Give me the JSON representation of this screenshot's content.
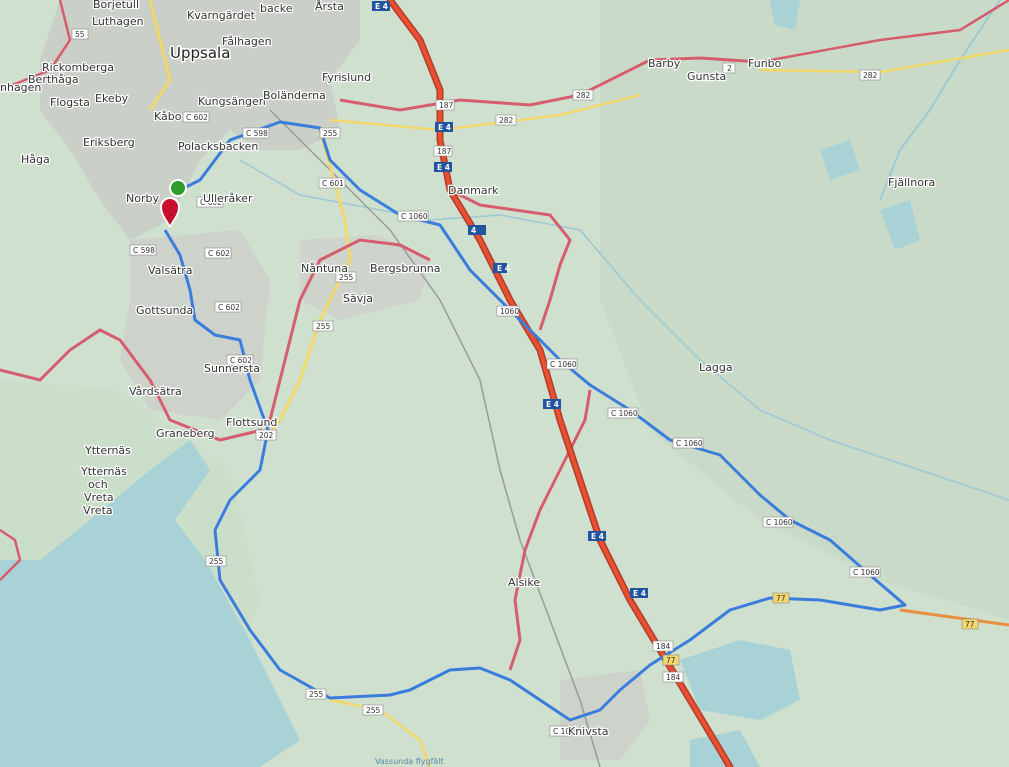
{
  "map": {
    "places": [
      {
        "id": "borjetull",
        "label": "Borjetull"
      },
      {
        "id": "luthagen",
        "label": "Luthagen"
      },
      {
        "id": "kvarngardet",
        "label": "Kvarngärdet"
      },
      {
        "id": "backe",
        "label": "backe"
      },
      {
        "id": "arsta",
        "label": "Årsta"
      },
      {
        "id": "uppsala",
        "label": "Uppsala"
      },
      {
        "id": "falhagen",
        "label": "Fålhagen"
      },
      {
        "id": "rickomberga",
        "label": "Rickomberga"
      },
      {
        "id": "berthaga",
        "label": "Berthåga"
      },
      {
        "id": "nhagen",
        "label": "nhagen"
      },
      {
        "id": "flogsta",
        "label": "Flogsta"
      },
      {
        "id": "ekeby",
        "label": "Ekeby"
      },
      {
        "id": "fyrislund",
        "label": "Fyrislund"
      },
      {
        "id": "kungsangen",
        "label": "Kungsängen"
      },
      {
        "id": "bolanderna",
        "label": "Boländerna"
      },
      {
        "id": "kabo",
        "label": "Kåbo"
      },
      {
        "id": "eriksberg",
        "label": "Eriksberg"
      },
      {
        "id": "polacksbacken",
        "label": "Polacksbacken"
      },
      {
        "id": "haga",
        "label": "Håga"
      },
      {
        "id": "norby",
        "label": "Norby"
      },
      {
        "id": "ulleraker",
        "label": "Ulleråker"
      },
      {
        "id": "danmark",
        "label": "Danmark"
      },
      {
        "id": "valsatra",
        "label": "Valsätra"
      },
      {
        "id": "nantuna",
        "label": "Nåntuna"
      },
      {
        "id": "bergsbrunna",
        "label": "Bergsbrunna"
      },
      {
        "id": "savja",
        "label": "Sävja"
      },
      {
        "id": "gottsunda",
        "label": "Gottsunda"
      },
      {
        "id": "sunnersta",
        "label": "Sunnersta"
      },
      {
        "id": "vardsatra",
        "label": "Vårdsätra"
      },
      {
        "id": "graneberg",
        "label": "Graneberg"
      },
      {
        "id": "flottsund",
        "label": "Flottsund"
      },
      {
        "id": "ytternas",
        "label": "Ytternäs"
      },
      {
        "id": "ytternas_och_vreta_1",
        "label": "Ytternäs"
      },
      {
        "id": "ytternas_och_vreta_2",
        "label": "och"
      },
      {
        "id": "ytternas_och_vreta_3",
        "label": "Vreta"
      },
      {
        "id": "ytternas_och_vreta_4",
        "label": "Vreta"
      },
      {
        "id": "barby",
        "label": "Barby"
      },
      {
        "id": "gunsta",
        "label": "Gunsta"
      },
      {
        "id": "funbo",
        "label": "Funbo"
      },
      {
        "id": "fjallnora",
        "label": "Fjällnora"
      },
      {
        "id": "lagga",
        "label": "Lagga"
      },
      {
        "id": "alsike",
        "label": "Alsike"
      },
      {
        "id": "knivsta",
        "label": "Knivsta"
      },
      {
        "id": "vassunda",
        "label": "Vassunda flygfält"
      }
    ],
    "e_shields": [
      "E 4",
      "E 4",
      "E 4",
      "4",
      "E 4",
      "E 4",
      "E 4",
      "E 4"
    ],
    "road_shields": [
      {
        "id": "s55",
        "text": "55"
      },
      {
        "id": "s187a",
        "text": "187"
      },
      {
        "id": "s187b",
        "text": "187"
      },
      {
        "id": "s282a",
        "text": "282"
      },
      {
        "id": "s282b",
        "text": "282"
      },
      {
        "id": "s282c",
        "text": "282"
      },
      {
        "id": "s2",
        "text": "2"
      },
      {
        "id": "sc602a",
        "text": "C 602"
      },
      {
        "id": "sc602b",
        "text": "C 602"
      },
      {
        "id": "sc602c",
        "text": "C 602"
      },
      {
        "id": "sc602d",
        "text": "C 602"
      },
      {
        "id": "sc602e",
        "text": "C 602"
      },
      {
        "id": "sc598a",
        "text": "C 598"
      },
      {
        "id": "sc598b",
        "text": "C 598"
      },
      {
        "id": "s255a",
        "text": "255"
      },
      {
        "id": "s255b",
        "text": "255"
      },
      {
        "id": "s255c",
        "text": "255"
      },
      {
        "id": "s255d",
        "text": "255"
      },
      {
        "id": "s255e",
        "text": "255"
      },
      {
        "id": "s255f",
        "text": "255"
      },
      {
        "id": "sc601",
        "text": "C 601"
      },
      {
        "id": "sc1060a",
        "text": "C 1060"
      },
      {
        "id": "s1060",
        "text": "1060"
      },
      {
        "id": "sc1060b",
        "text": "C 1060"
      },
      {
        "id": "sc1060c",
        "text": "C 1060"
      },
      {
        "id": "sc1060d",
        "text": "C 1060"
      },
      {
        "id": "sc1060e",
        "text": "C 1060"
      },
      {
        "id": "sc1060f",
        "text": "C 1060"
      },
      {
        "id": "s202",
        "text": "202"
      },
      {
        "id": "s184a",
        "text": "184"
      },
      {
        "id": "s184b",
        "text": "184"
      },
      {
        "id": "s77a",
        "text": "77"
      },
      {
        "id": "s77b",
        "text": "77"
      },
      {
        "id": "s77c",
        "text": "77"
      },
      {
        "id": "sc10",
        "text": "C 10"
      }
    ],
    "markers": {
      "start": {
        "color": "#2e9b2e",
        "name": "start-marker"
      },
      "end": {
        "color": "#c8102e",
        "name": "end-marker"
      }
    },
    "colors": {
      "route": "#3b7ddd",
      "motorway": "#e8502f",
      "primary": "#d65d6d",
      "secondary": "#f2d76a",
      "water": "#a8d2d6",
      "land": "#cfe0cf",
      "urban": "#c9cbc6"
    }
  }
}
